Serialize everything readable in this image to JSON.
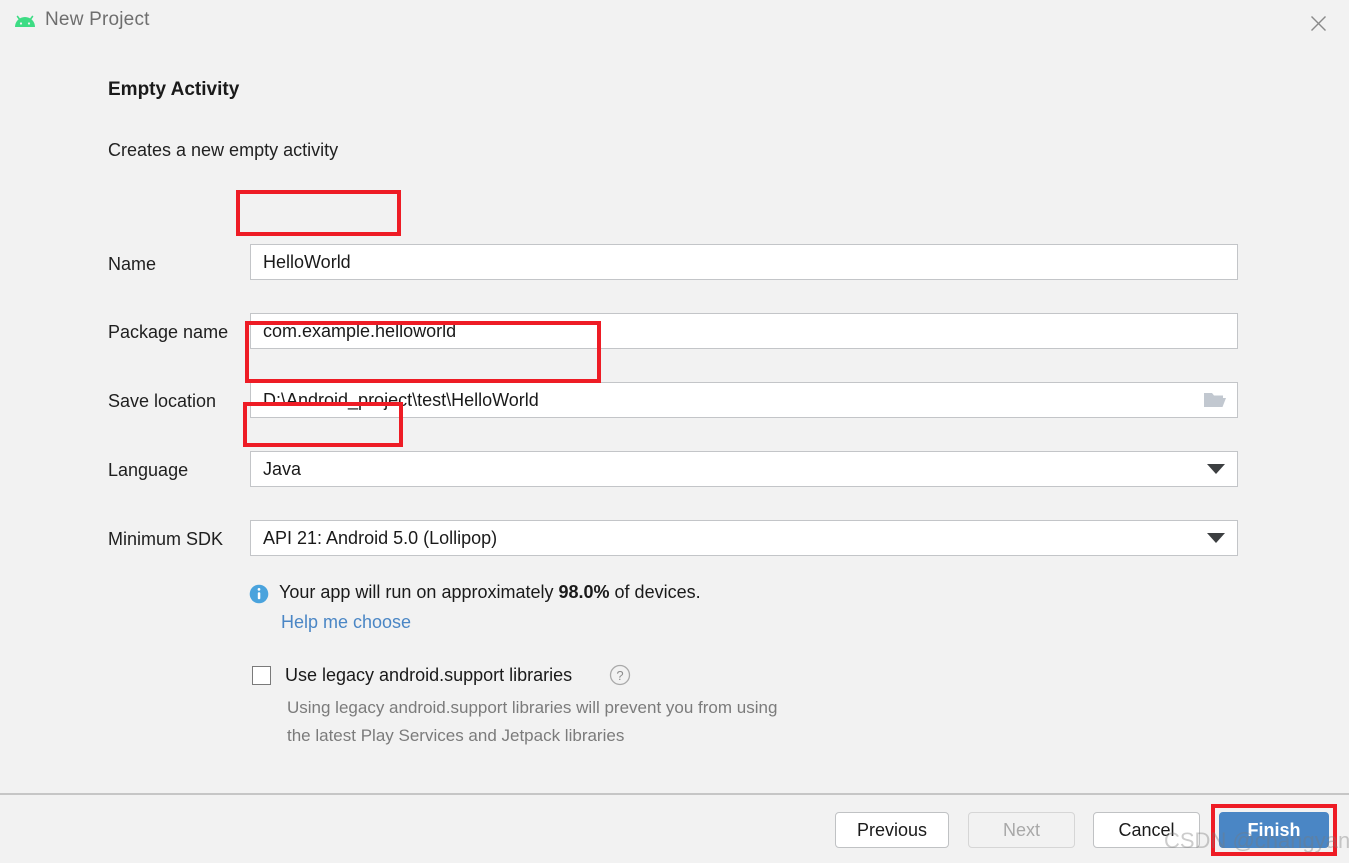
{
  "window": {
    "title": "New Project",
    "app_icon": "android-robot-icon",
    "close_icon": "close-icon"
  },
  "header": {
    "heading": "Empty Activity",
    "subheading": "Creates a new empty activity"
  },
  "form": {
    "fields": [
      {
        "label": "Name",
        "value": "HelloWorld",
        "control": "text",
        "annotated": true
      },
      {
        "label": "Package name",
        "value": "com.example.helloworld",
        "control": "text",
        "annotated": false
      },
      {
        "label": "Save location",
        "value": "D:\\Android_project\\test\\HelloWorld",
        "control": "browse",
        "annotated": true
      },
      {
        "label": "Language",
        "value": "Java",
        "control": "dropdown",
        "annotated": true
      },
      {
        "label": "Minimum SDK",
        "value": "API 21: Android 5.0 (Lollipop)",
        "control": "dropdown",
        "annotated": false
      }
    ],
    "browse_icon": "folder-open-icon",
    "dropdown_icon": "chevron-down-icon"
  },
  "sdk_info": {
    "icon": "info-icon",
    "text_prefix": "Your app will run on approximately ",
    "percent": "98.0%",
    "text_suffix": " of devices.",
    "help_link": "Help me choose"
  },
  "legacy": {
    "checkbox_label": "Use legacy android.support libraries",
    "checked": false,
    "help_icon": "question-mark-icon",
    "description_line1": "Using legacy android.support libraries will prevent you from using",
    "description_line2": "the latest Play Services and Jetpack libraries"
  },
  "footer": {
    "previous_label": "Previous",
    "next_label": "Next",
    "next_disabled": true,
    "cancel_label": "Cancel",
    "finish_label": "Finish",
    "finish_annotated": true
  },
  "watermark": "CSDN @changyana",
  "colors": {
    "accent": "#4a86c5",
    "annotation": "#ee1c25",
    "android_green": "#3ddc84",
    "info_blue": "#4aa3dd",
    "background": "#f2f2f2"
  }
}
